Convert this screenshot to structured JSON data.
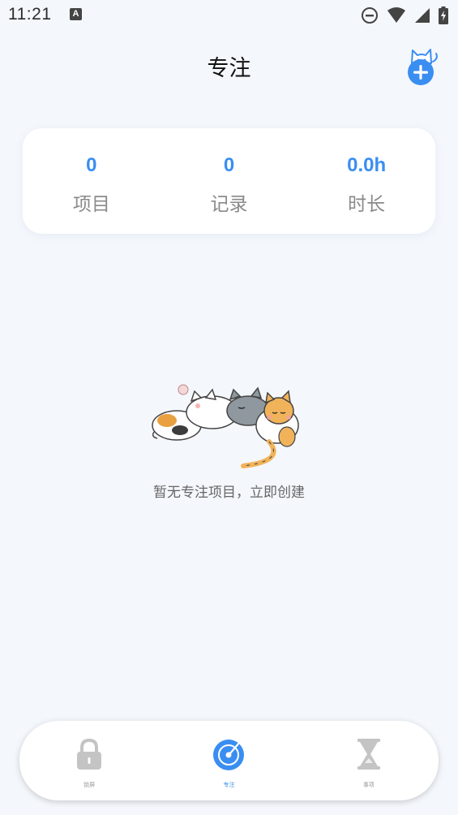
{
  "status_bar": {
    "time": "11:21",
    "notification_icon": "a-letter-icon",
    "right_icons": [
      "do-not-disturb-icon",
      "wifi-icon",
      "cell-signal-icon",
      "battery-charging-icon"
    ]
  },
  "header": {
    "title": "专注",
    "add_icon": "cat-plus-icon"
  },
  "stats": [
    {
      "value": "0",
      "label": "项目"
    },
    {
      "value": "0",
      "label": "记录"
    },
    {
      "value": "0.0h",
      "label": "时长"
    }
  ],
  "empty_state": {
    "illustration": "sleeping-cats-illustration",
    "message": "暂无专注项目，立即创建"
  },
  "bottom_nav": {
    "items": [
      {
        "label": "锁屏",
        "icon": "lock-icon",
        "active": false
      },
      {
        "label": "专注",
        "icon": "focus-icon",
        "active": true
      },
      {
        "label": "事项",
        "icon": "hourglass-icon",
        "active": false
      }
    ]
  },
  "colors": {
    "accent": "#3a8ef1",
    "background": "#f4f7fc",
    "card": "#ffffff",
    "inactive_icon": "#c4c4c4"
  }
}
